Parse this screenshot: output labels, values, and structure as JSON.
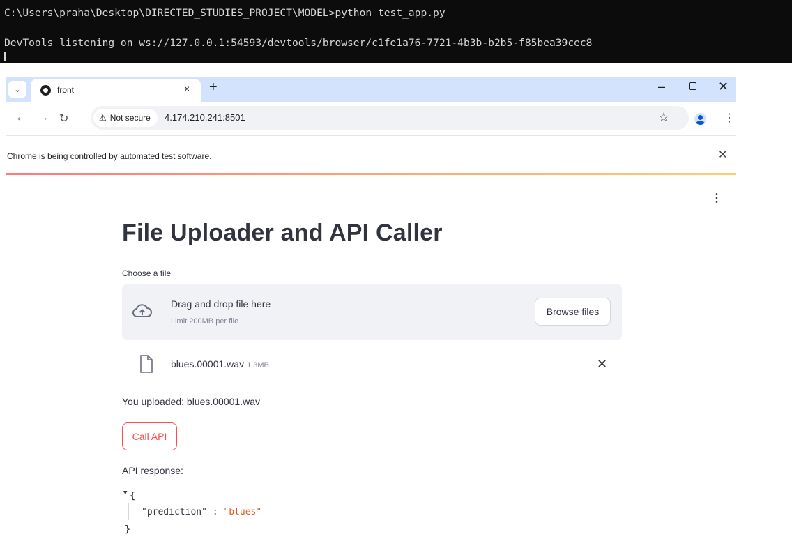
{
  "terminal": {
    "line1": "C:\\Users\\praha\\Desktop\\DIRECTED_STUDIES_PROJECT\\MODEL>python test_app.py",
    "line2": "DevTools listening on ws://127.0.0.1:54593/devtools/browser/c1fe1a76-7721-4b3b-b2b5-f85bea39cec8"
  },
  "browser": {
    "tab_title": "front",
    "new_tab": "+",
    "tab_close": "×",
    "security_label": "Not secure",
    "url": "4.174.210.241:8501",
    "infobar_text": "Chrome is being controlled by automated test software."
  },
  "app": {
    "title": "File Uploader and API Caller",
    "uploader_label": "Choose a file",
    "dropzone_title": "Drag and drop file here",
    "dropzone_limit": "Limit 200MB per file",
    "browse_label": "Browse files",
    "file_name": "blues.00001.wav",
    "file_size": "1.3MB",
    "uploaded_text": "You uploaded: blues.00001.wav",
    "call_button": "Call API",
    "response_label": "API response:",
    "response": {
      "key": "\"prediction\"",
      "value": "\"blues\""
    }
  },
  "icons": {
    "tab_menu": "chevron-down-icon",
    "favicon": "streamlit-favicon-icon",
    "back": "arrow-left-icon",
    "forward": "arrow-right-icon",
    "reload": "reload-icon",
    "warning": "warning-triangle-icon",
    "bookmark": "star-icon",
    "profile": "profile-icon",
    "menu": "kebab-menu-icon",
    "upload": "cloud-upload-icon",
    "file": "file-icon",
    "close": "close-icon"
  },
  "colors": {
    "terminal_bg": "#0c0c0c",
    "tabbar_bg": "#d3e3fd",
    "dropzone_bg": "#f0f2f6",
    "primary": "#ff4b4b",
    "json_string": "#e25822"
  }
}
